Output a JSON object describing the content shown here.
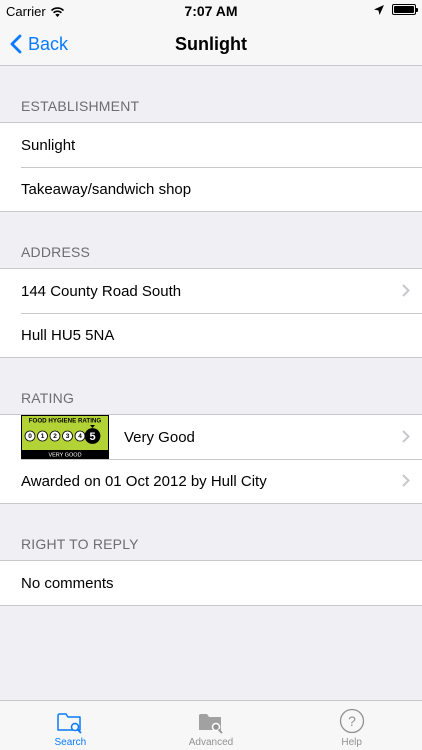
{
  "status_bar": {
    "carrier": "Carrier",
    "time": "7:07 AM",
    "battery_level": 1.0
  },
  "nav": {
    "back_label": "Back",
    "title": "Sunlight"
  },
  "sections": {
    "establishment": {
      "header": "ESTABLISHMENT",
      "name": "Sunlight",
      "type": "Takeaway/sandwich shop"
    },
    "address": {
      "header": "ADDRESS",
      "line1": "144 County Road South",
      "line2": "Hull HU5 5NA"
    },
    "rating": {
      "header": "RATING",
      "badge_title": "FOOD HYGIENE RATING",
      "badge_scale": [
        "0",
        "1",
        "2",
        "3",
        "4",
        "5"
      ],
      "badge_value": "5",
      "badge_footer": "VERY GOOD",
      "rating_text": "Very Good",
      "awarded": "Awarded on 01 Oct 2012 by Hull City"
    },
    "reply": {
      "header": "RIGHT TO REPLY",
      "text": "No comments"
    }
  },
  "tabs": [
    {
      "label": "Search",
      "icon": "folder-search-icon",
      "active": true
    },
    {
      "label": "Advanced",
      "icon": "folder-advanced-icon",
      "active": false
    },
    {
      "label": "Help",
      "icon": "question-circle-icon",
      "active": false
    }
  ],
  "colors": {
    "accent": "#0a7aff",
    "badge_green": "#b2d235",
    "inactive": "#929292"
  }
}
